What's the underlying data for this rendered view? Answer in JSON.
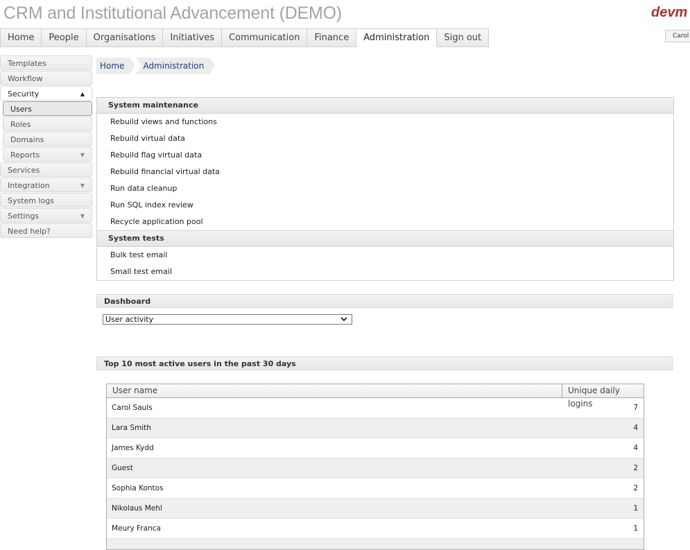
{
  "app": {
    "title": "CRM and Institutional Advancement (DEMO)",
    "brand": "devm",
    "user_chip": "Carol Z"
  },
  "topnav": {
    "tabs": [
      "Home",
      "People",
      "Organisations",
      "Initiatives",
      "Communication",
      "Finance",
      "Administration",
      "Sign out"
    ],
    "active": "Administration"
  },
  "sidebar": {
    "templates": "Templates",
    "workflow": "Workflow",
    "security": "Security",
    "users": "Users",
    "roles": "Roles",
    "domains": "Domains",
    "reports": "Reports",
    "services": "Services",
    "integration": "Integration",
    "system_logs": "System logs",
    "settings": "Settings",
    "need_help": "Need help?"
  },
  "breadcrumb": {
    "home": "Home",
    "administration": "Administration"
  },
  "maintenance": {
    "title": "System maintenance",
    "links": [
      "Rebuild views and functions",
      "Rebuild virtual data",
      "Rebuild flag virtual data",
      "Rebuild financial virtual data",
      "Run data cleanup",
      "Run SQL index review",
      "Recycle application pool"
    ],
    "tests_title": "System tests",
    "tests": [
      "Bulk test email",
      "Small test email"
    ]
  },
  "dashboard": {
    "title": "Dashboard",
    "selected": "User activity"
  },
  "top_users": {
    "title": "Top 10 most active users in the past 30 days",
    "columns": {
      "name": "User name",
      "logins": "Unique daily logins"
    },
    "rows": [
      {
        "name": "Carol Sauls",
        "logins": "7"
      },
      {
        "name": "Lara Smith",
        "logins": "4"
      },
      {
        "name": "James Kydd",
        "logins": "4"
      },
      {
        "name": "Guest",
        "logins": "2"
      },
      {
        "name": "Sophia Kontos",
        "logins": "2"
      },
      {
        "name": "Nikolaus Mehl",
        "logins": "1"
      },
      {
        "name": "Meury Franca",
        "logins": "1"
      }
    ]
  }
}
